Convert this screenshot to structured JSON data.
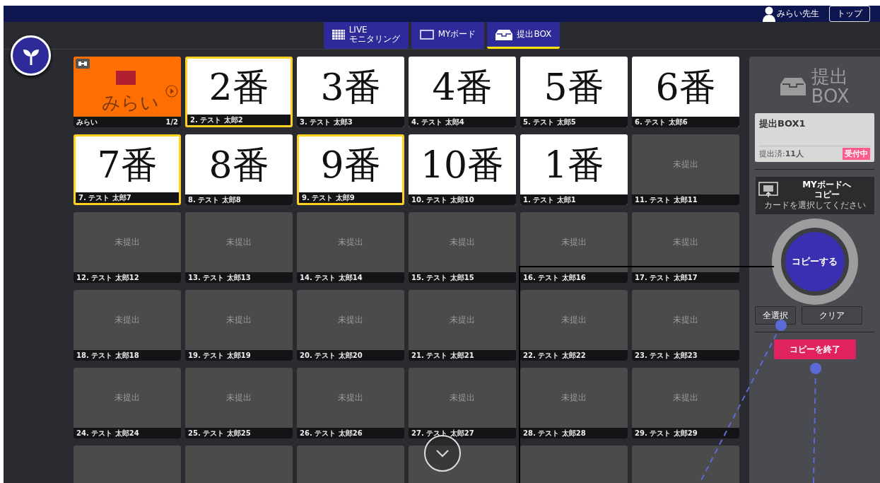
{
  "header": {
    "user": "みらい先生",
    "top_button": "トップ"
  },
  "tabs": [
    {
      "kind": "live",
      "label": "LIVE",
      "sublabel": "モニタリング",
      "selected": false
    },
    {
      "kind": "board",
      "label": "MYボード",
      "selected": false
    },
    {
      "kind": "box",
      "label": "提出BOX",
      "selected": true
    }
  ],
  "cards": [
    {
      "kind": "owner",
      "title": "みらい",
      "label": "みらい",
      "page": "1/2",
      "selected": false
    },
    {
      "kind": "answer",
      "content": "2番",
      "label": "2. テスト 太郎2",
      "selected": true
    },
    {
      "kind": "answer",
      "content": "3番",
      "label": "3. テスト 太郎3",
      "selected": false
    },
    {
      "kind": "answer",
      "content": "4番",
      "label": "4. テスト 太郎4",
      "selected": false
    },
    {
      "kind": "answer",
      "content": "5番",
      "label": "5. テスト 太郎5",
      "selected": false
    },
    {
      "kind": "answer",
      "content": "6番",
      "label": "6. テスト 太郎6",
      "selected": false
    },
    {
      "kind": "answer",
      "content": "7番",
      "label": "7. テスト 太郎7",
      "selected": true
    },
    {
      "kind": "answer",
      "content": "8番",
      "label": "8. テスト 太郎8",
      "selected": false
    },
    {
      "kind": "answer",
      "content": "9番",
      "label": "9. テスト 太郎9",
      "selected": true
    },
    {
      "kind": "answer",
      "content": "10番",
      "label": "10. テスト 太郎10",
      "selected": false
    },
    {
      "kind": "answer",
      "content": "1番",
      "label": "1. テスト 太郎1",
      "selected": false
    },
    {
      "kind": "unsubmitted",
      "status": "未提出",
      "label": "11. テスト 太郎11",
      "selected": false
    },
    {
      "kind": "unsubmitted",
      "status": "未提出",
      "label": "12. テスト 太郎12",
      "selected": false
    },
    {
      "kind": "unsubmitted",
      "status": "未提出",
      "label": "13. テスト 太郎13",
      "selected": false
    },
    {
      "kind": "unsubmitted",
      "status": "未提出",
      "label": "14. テスト 太郎14",
      "selected": false
    },
    {
      "kind": "unsubmitted",
      "status": "未提出",
      "label": "15. テスト 太郎15",
      "selected": false
    },
    {
      "kind": "unsubmitted",
      "status": "未提出",
      "label": "16. テスト 太郎16",
      "selected": false
    },
    {
      "kind": "unsubmitted",
      "status": "未提出",
      "label": "17. テスト 太郎17",
      "selected": false
    },
    {
      "kind": "unsubmitted",
      "status": "未提出",
      "label": "18. テスト 太郎18",
      "selected": false
    },
    {
      "kind": "unsubmitted",
      "status": "未提出",
      "label": "19. テスト 太郎19",
      "selected": false
    },
    {
      "kind": "unsubmitted",
      "status": "未提出",
      "label": "20. テスト 太郎20",
      "selected": false
    },
    {
      "kind": "unsubmitted",
      "status": "未提出",
      "label": "21. テスト 太郎21",
      "selected": false
    },
    {
      "kind": "unsubmitted",
      "status": "未提出",
      "label": "22. テスト 太郎22",
      "selected": false
    },
    {
      "kind": "unsubmitted",
      "status": "未提出",
      "label": "23. テスト 太郎23",
      "selected": false
    },
    {
      "kind": "unsubmitted",
      "status": "未提出",
      "label": "24. テスト 太郎24",
      "selected": false
    },
    {
      "kind": "unsubmitted",
      "status": "未提出",
      "label": "25. テスト 太郎25",
      "selected": false
    },
    {
      "kind": "unsubmitted",
      "status": "未提出",
      "label": "26. テスト 太郎26",
      "selected": false
    },
    {
      "kind": "unsubmitted",
      "status": "未提出",
      "label": "27. テスト 太郎27",
      "selected": false
    },
    {
      "kind": "unsubmitted",
      "status": "未提出",
      "label": "28. テスト 太郎28",
      "selected": false
    },
    {
      "kind": "unsubmitted",
      "status": "未提出",
      "label": "29. テスト 太郎29",
      "selected": false
    },
    {
      "kind": "hidden",
      "selected": false
    },
    {
      "kind": "hidden",
      "selected": false
    },
    {
      "kind": "hidden",
      "selected": false
    },
    {
      "kind": "hidden",
      "selected": false
    },
    {
      "kind": "hidden",
      "selected": false
    },
    {
      "kind": "hidden",
      "selected": false
    }
  ],
  "panel": {
    "title_line1": "提出",
    "title_line2": "BOX",
    "box_name": "提出BOX1",
    "submitted": "提出済:**11人**",
    "status_badge": "受付中",
    "copy_title_line1": "MYボードへ",
    "copy_title_line2": "コピー",
    "copy_hint": "カードを選択してください",
    "copy_button": "コピーする",
    "select_all": "全選択",
    "clear": "クリア",
    "end_copy": "コピーを終了"
  }
}
